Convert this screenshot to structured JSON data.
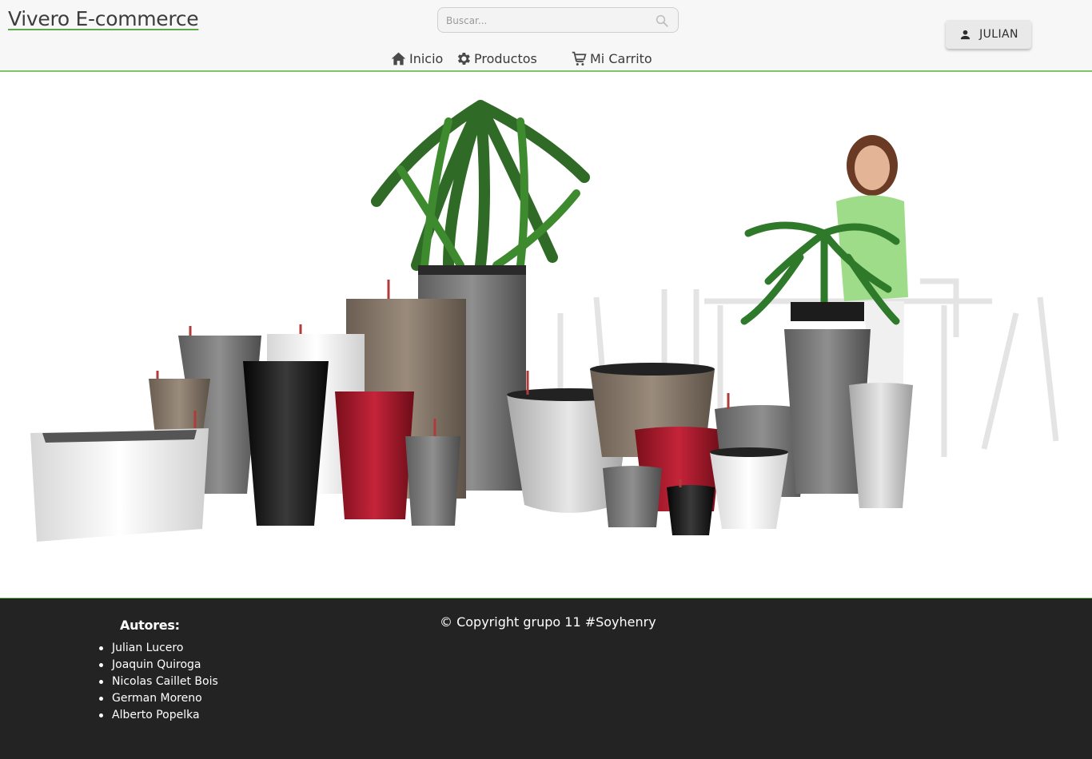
{
  "header": {
    "brand": "Vivero E-commerce",
    "search": {
      "placeholder": "Buscar..."
    },
    "user_button": {
      "label": "JULIAN",
      "icon": "person-icon"
    },
    "nav": [
      {
        "label": "Inicio",
        "icon": "home-icon"
      },
      {
        "label": "Productos",
        "icon": "gear-icon"
      },
      {
        "label": "Mi Carrito",
        "icon": "cart-icon"
      }
    ]
  },
  "hero": {
    "image": "plant-pots-hero"
  },
  "footer": {
    "authors_title": "Autores:",
    "authors": [
      "Julian Lucero",
      "Joaquin Quiroga",
      "Nicolas Caillet Bois",
      "German Moreno",
      "Alberto Popelka"
    ],
    "copyright": "© Copyright grupo 11 #Soyhenry"
  },
  "colors": {
    "accent": "#7fc46a",
    "footer_bg": "#232323",
    "header_bg": "#f7f7f7"
  }
}
